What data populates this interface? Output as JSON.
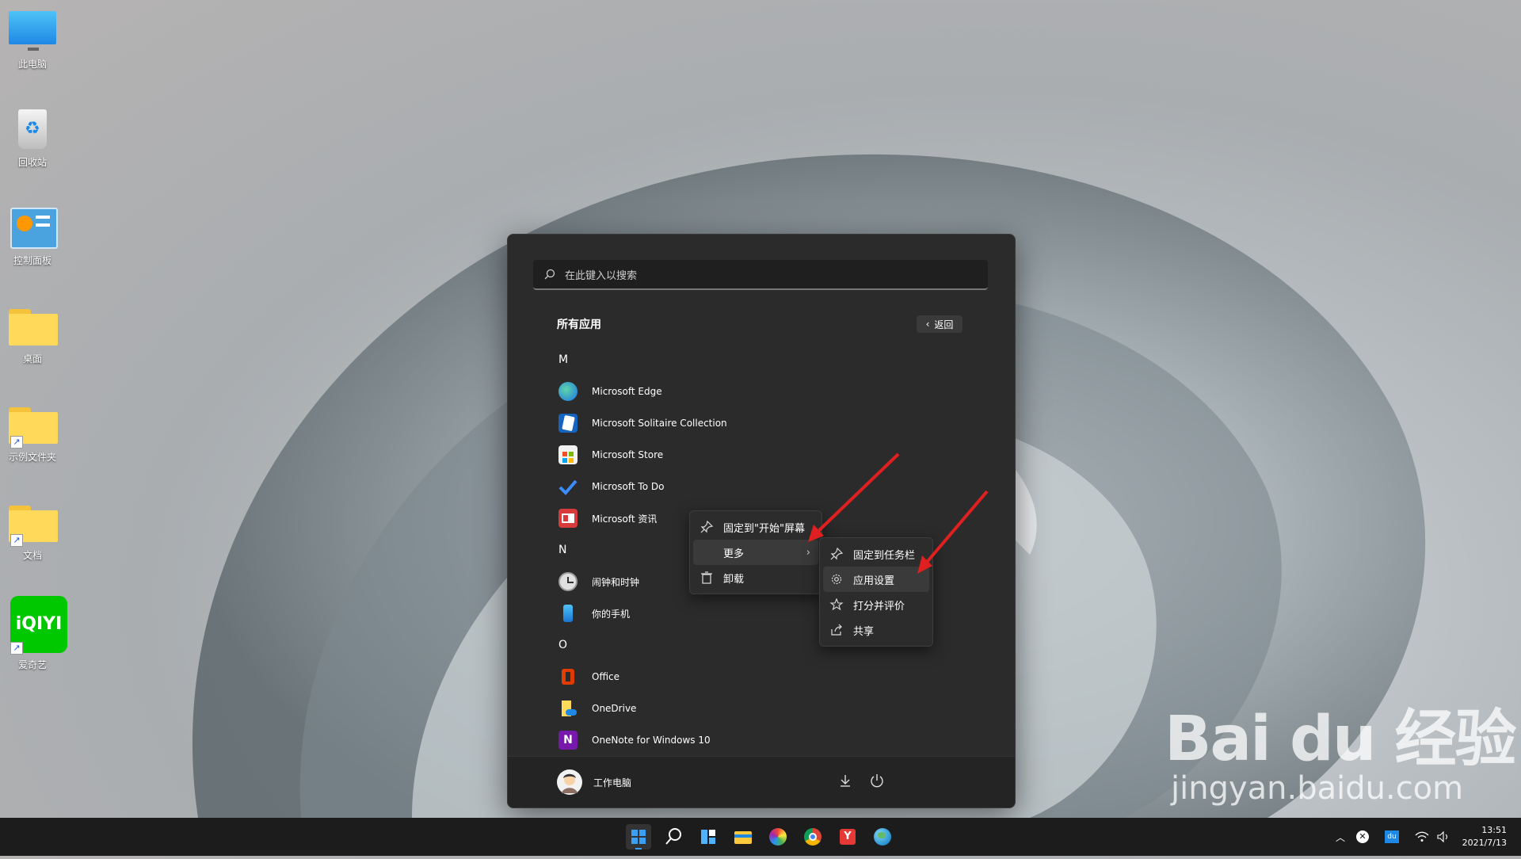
{
  "desktop": {
    "icons": [
      {
        "label": "此电脑",
        "icon": "computer-icon"
      },
      {
        "label": "回收站",
        "icon": "recycle-bin-icon"
      },
      {
        "label": "控制面板",
        "icon": "control-panel-icon"
      },
      {
        "label": "桌面",
        "icon": "folder-icon"
      },
      {
        "label": "示例文件夹",
        "icon": "folder-icon"
      },
      {
        "label": "文档",
        "icon": "folder-icon"
      },
      {
        "label": "爱奇艺",
        "icon": "iqiyi-icon",
        "logo_text": "iQIYI"
      }
    ]
  },
  "start": {
    "search_placeholder": "在此键入以搜索",
    "all_apps": "所有应用",
    "back": "返回",
    "groups": [
      {
        "letter": "M",
        "apps": [
          {
            "name": "Microsoft Edge",
            "icon": "edge-icon"
          },
          {
            "name": "Microsoft Solitaire Collection",
            "icon": "solitaire-icon"
          },
          {
            "name": "Microsoft Store",
            "icon": "store-icon"
          },
          {
            "name": "Microsoft To Do",
            "icon": "todo-icon"
          },
          {
            "name": "Microsoft 资讯",
            "icon": "news-icon"
          }
        ]
      },
      {
        "letter": "N",
        "apps": [
          {
            "name": "闹钟和时钟",
            "icon": "clock-icon"
          },
          {
            "name": "你的手机",
            "icon": "phone-icon"
          }
        ]
      },
      {
        "letter": "O",
        "apps": [
          {
            "name": "Office",
            "icon": "office-icon"
          },
          {
            "name": "OneDrive",
            "icon": "onedrive-icon"
          },
          {
            "name": "OneNote for Windows 10",
            "icon": "onenote-icon"
          }
        ]
      }
    ],
    "user": "工作电脑"
  },
  "context_menu": {
    "pin_start": "固定到\"开始\"屏幕",
    "more": "更多",
    "uninstall": "卸载"
  },
  "submenu": {
    "pin_taskbar": "固定到任务栏",
    "app_settings": "应用设置",
    "rate_review": "打分并评价",
    "share": "共享"
  },
  "taskbar": {
    "time": "13:51",
    "date": "2021/7/13",
    "ime_label": "du"
  },
  "watermark": {
    "brand": "Bai du 经验",
    "url": "jingyan.baidu.com"
  },
  "colors": {
    "accent": "#0078d4",
    "arrow": "#e02020"
  }
}
